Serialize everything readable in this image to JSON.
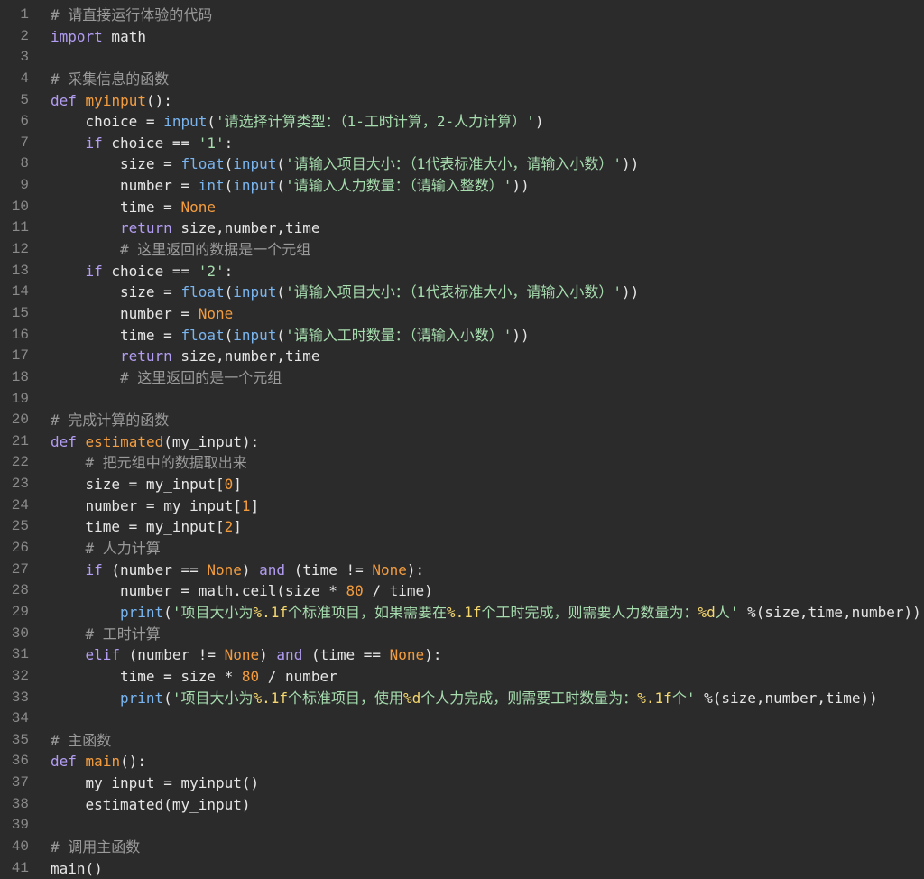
{
  "editor": {
    "lines": [
      {
        "n": "1",
        "indent": 0,
        "tokens": [
          {
            "t": "cmt",
            "v": "# 请直接运行体验的代码"
          }
        ]
      },
      {
        "n": "2",
        "indent": 0,
        "tokens": [
          {
            "t": "kw",
            "v": "import"
          },
          {
            "t": "txt",
            "v": " math"
          }
        ]
      },
      {
        "n": "3",
        "indent": 0,
        "tokens": []
      },
      {
        "n": "4",
        "indent": 0,
        "tokens": [
          {
            "t": "cmt",
            "v": "# 采集信息的函数"
          }
        ]
      },
      {
        "n": "5",
        "indent": 0,
        "tokens": [
          {
            "t": "kw",
            "v": "def"
          },
          {
            "t": "txt",
            "v": " "
          },
          {
            "t": "fn",
            "v": "myinput"
          },
          {
            "t": "txt",
            "v": "():"
          }
        ]
      },
      {
        "n": "6",
        "indent": 1,
        "tokens": [
          {
            "t": "txt",
            "v": "choice = "
          },
          {
            "t": "call",
            "v": "input"
          },
          {
            "t": "txt",
            "v": "("
          },
          {
            "t": "str",
            "v": "'请选择计算类型：（1-工时计算，2-人力计算）'"
          },
          {
            "t": "txt",
            "v": ")"
          }
        ]
      },
      {
        "n": "7",
        "indent": 1,
        "tokens": [
          {
            "t": "kw",
            "v": "if"
          },
          {
            "t": "txt",
            "v": " choice == "
          },
          {
            "t": "str",
            "v": "'1'"
          },
          {
            "t": "txt",
            "v": ":"
          }
        ]
      },
      {
        "n": "8",
        "indent": 2,
        "tokens": [
          {
            "t": "txt",
            "v": "size = "
          },
          {
            "t": "call",
            "v": "float"
          },
          {
            "t": "txt",
            "v": "("
          },
          {
            "t": "call",
            "v": "input"
          },
          {
            "t": "txt",
            "v": "("
          },
          {
            "t": "str",
            "v": "'请输入项目大小：（1代表标准大小，请输入小数）'"
          },
          {
            "t": "txt",
            "v": "))"
          }
        ]
      },
      {
        "n": "9",
        "indent": 2,
        "tokens": [
          {
            "t": "txt",
            "v": "number = "
          },
          {
            "t": "call",
            "v": "int"
          },
          {
            "t": "txt",
            "v": "("
          },
          {
            "t": "call",
            "v": "input"
          },
          {
            "t": "txt",
            "v": "("
          },
          {
            "t": "str",
            "v": "'请输入人力数量：（请输入整数）'"
          },
          {
            "t": "txt",
            "v": "))"
          }
        ]
      },
      {
        "n": "10",
        "indent": 2,
        "tokens": [
          {
            "t": "txt",
            "v": "time = "
          },
          {
            "t": "const",
            "v": "None"
          }
        ]
      },
      {
        "n": "11",
        "indent": 2,
        "tokens": [
          {
            "t": "kw",
            "v": "return"
          },
          {
            "t": "txt",
            "v": " size,number,time"
          }
        ]
      },
      {
        "n": "12",
        "indent": 2,
        "tokens": [
          {
            "t": "cmt",
            "v": "# 这里返回的数据是一个元组"
          }
        ]
      },
      {
        "n": "13",
        "indent": 1,
        "tokens": [
          {
            "t": "kw",
            "v": "if"
          },
          {
            "t": "txt",
            "v": " choice == "
          },
          {
            "t": "str",
            "v": "'2'"
          },
          {
            "t": "txt",
            "v": ":"
          }
        ]
      },
      {
        "n": "14",
        "indent": 2,
        "tokens": [
          {
            "t": "txt",
            "v": "size = "
          },
          {
            "t": "call",
            "v": "float"
          },
          {
            "t": "txt",
            "v": "("
          },
          {
            "t": "call",
            "v": "input"
          },
          {
            "t": "txt",
            "v": "("
          },
          {
            "t": "str",
            "v": "'请输入项目大小：（1代表标准大小，请输入小数）'"
          },
          {
            "t": "txt",
            "v": "))"
          }
        ]
      },
      {
        "n": "15",
        "indent": 2,
        "tokens": [
          {
            "t": "txt",
            "v": "number = "
          },
          {
            "t": "const",
            "v": "None"
          }
        ]
      },
      {
        "n": "16",
        "indent": 2,
        "tokens": [
          {
            "t": "txt",
            "v": "time = "
          },
          {
            "t": "call",
            "v": "float"
          },
          {
            "t": "txt",
            "v": "("
          },
          {
            "t": "call",
            "v": "input"
          },
          {
            "t": "txt",
            "v": "("
          },
          {
            "t": "str",
            "v": "'请输入工时数量：（请输入小数）'"
          },
          {
            "t": "txt",
            "v": "))"
          }
        ]
      },
      {
        "n": "17",
        "indent": 2,
        "tokens": [
          {
            "t": "kw",
            "v": "return"
          },
          {
            "t": "txt",
            "v": " size,number,time"
          }
        ]
      },
      {
        "n": "18",
        "indent": 2,
        "tokens": [
          {
            "t": "cmt",
            "v": "# 这里返回的是一个元组"
          }
        ]
      },
      {
        "n": "19",
        "indent": 0,
        "tokens": []
      },
      {
        "n": "20",
        "indent": 0,
        "tokens": [
          {
            "t": "cmt",
            "v": "# 完成计算的函数"
          }
        ]
      },
      {
        "n": "21",
        "indent": 0,
        "tokens": [
          {
            "t": "kw",
            "v": "def"
          },
          {
            "t": "txt",
            "v": " "
          },
          {
            "t": "fn",
            "v": "estimated"
          },
          {
            "t": "txt",
            "v": "(my_input):"
          }
        ]
      },
      {
        "n": "22",
        "indent": 1,
        "tokens": [
          {
            "t": "cmt",
            "v": "# 把元组中的数据取出来"
          }
        ]
      },
      {
        "n": "23",
        "indent": 1,
        "tokens": [
          {
            "t": "txt",
            "v": "size = my_input["
          },
          {
            "t": "num",
            "v": "0"
          },
          {
            "t": "txt",
            "v": "]"
          }
        ]
      },
      {
        "n": "24",
        "indent": 1,
        "tokens": [
          {
            "t": "txt",
            "v": "number = my_input["
          },
          {
            "t": "num",
            "v": "1"
          },
          {
            "t": "txt",
            "v": "]"
          }
        ]
      },
      {
        "n": "25",
        "indent": 1,
        "tokens": [
          {
            "t": "txt",
            "v": "time = my_input["
          },
          {
            "t": "num",
            "v": "2"
          },
          {
            "t": "txt",
            "v": "]"
          }
        ]
      },
      {
        "n": "26",
        "indent": 1,
        "tokens": [
          {
            "t": "cmt",
            "v": "# 人力计算"
          }
        ]
      },
      {
        "n": "27",
        "indent": 1,
        "tokens": [
          {
            "t": "kw",
            "v": "if"
          },
          {
            "t": "txt",
            "v": " (number == "
          },
          {
            "t": "const",
            "v": "None"
          },
          {
            "t": "txt",
            "v": ") "
          },
          {
            "t": "kw",
            "v": "and"
          },
          {
            "t": "txt",
            "v": " (time != "
          },
          {
            "t": "const",
            "v": "None"
          },
          {
            "t": "txt",
            "v": "):"
          }
        ]
      },
      {
        "n": "28",
        "indent": 2,
        "tokens": [
          {
            "t": "txt",
            "v": "number = math.ceil(size * "
          },
          {
            "t": "num",
            "v": "80"
          },
          {
            "t": "txt",
            "v": " / time)"
          }
        ]
      },
      {
        "n": "29",
        "indent": 2,
        "tokens": [
          {
            "t": "call",
            "v": "print"
          },
          {
            "t": "txt",
            "v": "("
          },
          {
            "t": "str",
            "v": "'项目大小为"
          },
          {
            "t": "fmt",
            "v": "%.1f"
          },
          {
            "t": "str",
            "v": "个标准项目，如果需要在"
          },
          {
            "t": "fmt",
            "v": "%.1f"
          },
          {
            "t": "str",
            "v": "个工时完成，则需要人力数量为："
          },
          {
            "t": "fmt",
            "v": "%d"
          },
          {
            "t": "str",
            "v": "人'"
          },
          {
            "t": "txt",
            "v": " %(size,time,number))"
          }
        ]
      },
      {
        "n": "30",
        "indent": 1,
        "tokens": [
          {
            "t": "cmt",
            "v": "# 工时计算"
          }
        ]
      },
      {
        "n": "31",
        "indent": 1,
        "tokens": [
          {
            "t": "kw",
            "v": "elif"
          },
          {
            "t": "txt",
            "v": " (number != "
          },
          {
            "t": "const",
            "v": "None"
          },
          {
            "t": "txt",
            "v": ") "
          },
          {
            "t": "kw",
            "v": "and"
          },
          {
            "t": "txt",
            "v": " (time == "
          },
          {
            "t": "const",
            "v": "None"
          },
          {
            "t": "txt",
            "v": "):"
          }
        ]
      },
      {
        "n": "32",
        "indent": 2,
        "tokens": [
          {
            "t": "txt",
            "v": "time = size * "
          },
          {
            "t": "num",
            "v": "80"
          },
          {
            "t": "txt",
            "v": " / number"
          }
        ]
      },
      {
        "n": "33",
        "indent": 2,
        "tokens": [
          {
            "t": "call",
            "v": "print"
          },
          {
            "t": "txt",
            "v": "("
          },
          {
            "t": "str",
            "v": "'项目大小为"
          },
          {
            "t": "fmt",
            "v": "%.1f"
          },
          {
            "t": "str",
            "v": "个标准项目，使用"
          },
          {
            "t": "fmt",
            "v": "%d"
          },
          {
            "t": "str",
            "v": "个人力完成，则需要工时数量为："
          },
          {
            "t": "fmt",
            "v": "%.1f"
          },
          {
            "t": "str",
            "v": "个'"
          },
          {
            "t": "txt",
            "v": " %(size,number,time))"
          }
        ]
      },
      {
        "n": "34",
        "indent": 0,
        "tokens": []
      },
      {
        "n": "35",
        "indent": 0,
        "tokens": [
          {
            "t": "cmt",
            "v": "# 主函数"
          }
        ]
      },
      {
        "n": "36",
        "indent": 0,
        "tokens": [
          {
            "t": "kw",
            "v": "def"
          },
          {
            "t": "txt",
            "v": " "
          },
          {
            "t": "fn",
            "v": "main"
          },
          {
            "t": "txt",
            "v": "():"
          }
        ]
      },
      {
        "n": "37",
        "indent": 1,
        "tokens": [
          {
            "t": "txt",
            "v": "my_input = myinput()"
          }
        ]
      },
      {
        "n": "38",
        "indent": 1,
        "tokens": [
          {
            "t": "txt",
            "v": "estimated(my_input)"
          }
        ]
      },
      {
        "n": "39",
        "indent": 0,
        "tokens": []
      },
      {
        "n": "40",
        "indent": 0,
        "tokens": [
          {
            "t": "cmt",
            "v": "# 调用主函数"
          }
        ]
      },
      {
        "n": "41",
        "indent": 0,
        "tokens": [
          {
            "t": "txt",
            "v": "main()"
          }
        ]
      }
    ]
  }
}
